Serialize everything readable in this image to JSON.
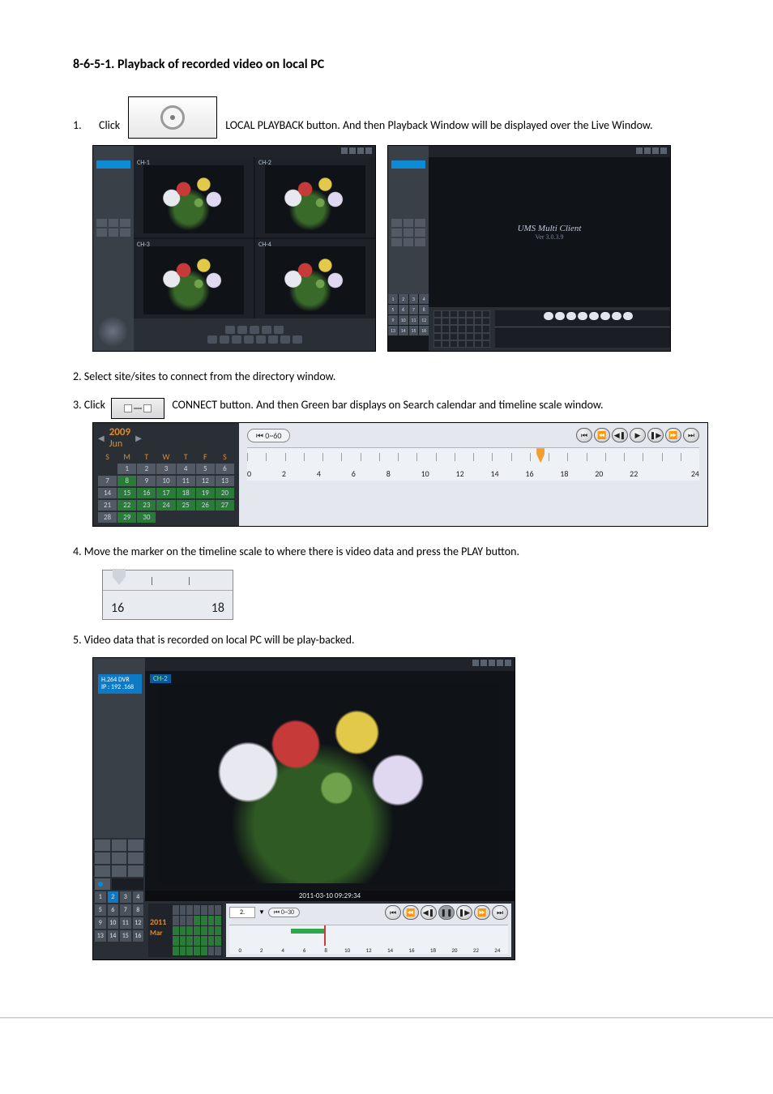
{
  "section_title": "8-6-5-1. Playback of recorded video on local PC",
  "step1_prefix_num": "1.",
  "step1_prefix": "Click",
  "step1_suffix": "LOCAL PLAYBACK button. And then Playback Window will be displayed over the Live Window.",
  "step2": "2. Select site/sites to connect from the directory window.",
  "step3_prefix": "3. Click",
  "step3_suffix": "CONNECT button. And then Green bar displays on Search calendar and timeline scale window.",
  "step4": "4. Move the marker on the timeline scale to where there is video data and press the PLAY button.",
  "step5": "5. Video data that is recorded on local PC will be play-backed.",
  "shotA": {
    "cam_labels": [
      "CH-1",
      "CH-2",
      "CH-3",
      "CH-4"
    ]
  },
  "shotB": {
    "brand": "UMS Multi Client",
    "version": "Ver 3.0.3.9",
    "month_label": "2011 Mar"
  },
  "timeline": {
    "year": "2009",
    "month": "Jun",
    "dow": [
      "S",
      "M",
      "T",
      "W",
      "T",
      "F",
      "S"
    ],
    "rows": [
      [
        "",
        "1",
        "2",
        "3",
        "4",
        "5",
        "6"
      ],
      [
        "7",
        "8",
        "9",
        "10",
        "11",
        "12",
        "13"
      ],
      [
        "14",
        "15",
        "16",
        "17",
        "18",
        "19",
        "20"
      ],
      [
        "21",
        "22",
        "23",
        "24",
        "25",
        "26",
        "27"
      ],
      [
        "28",
        "29",
        "30",
        "",
        "",
        "",
        ""
      ]
    ],
    "pill_label": "⏮ 0~60",
    "hours": [
      "0",
      "2",
      "4",
      "6",
      "8",
      "10",
      "12",
      "14",
      "16",
      "18",
      "20",
      "22",
      "24"
    ]
  },
  "marker_fig": {
    "labels": [
      "16",
      "18"
    ]
  },
  "shotC": {
    "sidebar_label_line1": "H.264 DVR",
    "sidebar_label_line2": "IP : 192 .168",
    "cam_label": "CH-2",
    "frame_time": "2011-03-10 09:29:34",
    "channel_numbers": [
      "1",
      "2",
      "3",
      "4",
      "5",
      "6",
      "7",
      "8",
      "9",
      "10",
      "11",
      "12",
      "13",
      "14",
      "15",
      "16"
    ],
    "cal_year": "2011",
    "cal_month": "Mar",
    "zoom": "2.",
    "pill_label": "⏮ 0~30",
    "hours": [
      "0",
      "2",
      "4",
      "6",
      "8",
      "10",
      "12",
      "14",
      "16",
      "18",
      "20",
      "22",
      "24"
    ]
  }
}
